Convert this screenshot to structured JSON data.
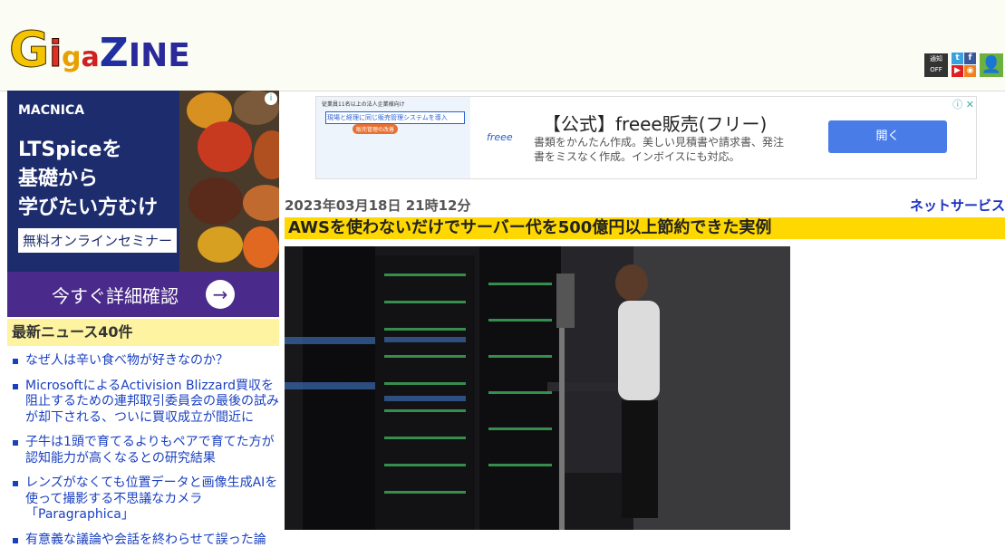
{
  "header": {
    "logo": {
      "p1": "G",
      "p2": "i",
      "p3": "g",
      "p4": "a",
      "p5": "Z",
      "p6": "INE"
    },
    "notify_label": "通知 OFF",
    "social": {
      "twitter": "t",
      "facebook": "f",
      "youtube": "▶",
      "rss": "◉"
    },
    "user_icon": "👤"
  },
  "side_ad": {
    "brand": "MACNICA",
    "headline": "LTSpiceを\n基礎から\n学びたい方むけ",
    "seminar": "無料オンラインセミナー",
    "cta": "今すぐ詳細確認",
    "arrow": "→",
    "info": "i"
  },
  "news": {
    "header": "最新ニュース40件",
    "items": [
      "なぜ人は辛い食べ物が好きなのか？",
      "MicrosoftによるActivision Blizzard買収を阻止するための連邦取引委員会の最後の試みが却下される、ついに買収成立が間近に",
      "子牛は1頭で育てるよりもペアで育てた方が認知能力が高くなるとの研究結果",
      "レンズがなくても位置データと画像生成AIを使って撮影する不思議なカメラ「Paragraphica」",
      "有意義な議論や会話を終わらせて誤った論"
    ]
  },
  "top_ad": {
    "tag": "従業員11名以上の法人企業様向け",
    "note": "現場と経理に同じ販売管理システムを導入",
    "pill": "販売管理の改善",
    "logo": "freee",
    "title": "【公式】freee販売(フリー)",
    "desc": "書類をかんたん作成。美しい見積書や請求書、発注書をミスなく作成。インボイスにも対応。",
    "button": "開く",
    "icons": "ⓘ ✕"
  },
  "article": {
    "date": "2023年03月18日 21時12分",
    "category": "ネットサービス",
    "title": "AWSを使わないだけでサーバー代を500億円以上節約できた実例"
  }
}
